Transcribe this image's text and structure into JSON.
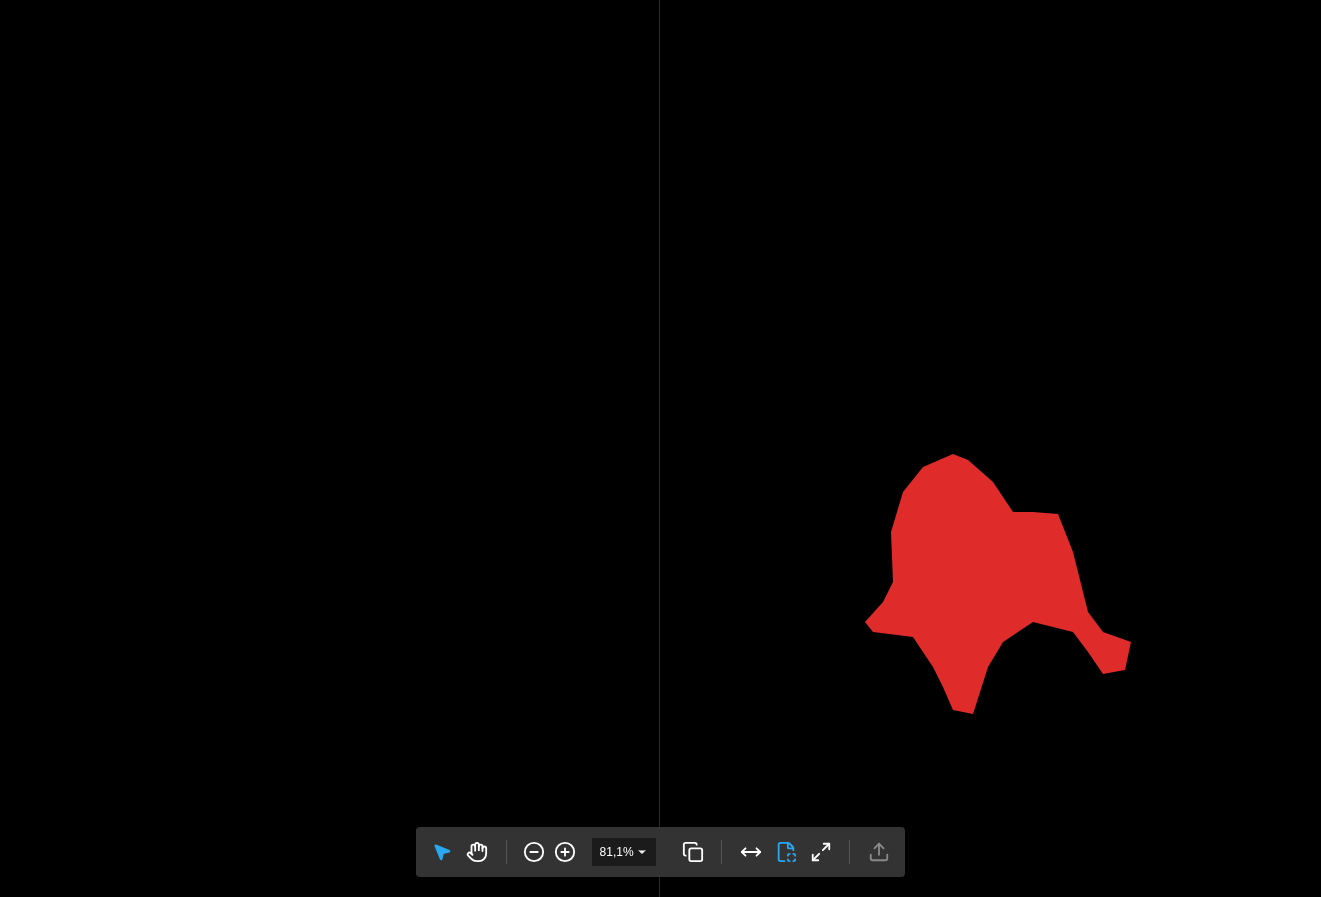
{
  "toolbar": {
    "tools": [
      {
        "kind": "pointer",
        "selected": true
      },
      {
        "kind": "hand",
        "selected": false
      }
    ],
    "zoom": {
      "value": "81,1%"
    },
    "views": [
      {
        "kind": "pages",
        "selected": false
      },
      {
        "kind": "fit-width",
        "selected": false
      },
      {
        "kind": "fit-page",
        "selected": true
      },
      {
        "kind": "fullscreen",
        "selected": false
      }
    ],
    "export": {
      "disabled": true
    }
  }
}
